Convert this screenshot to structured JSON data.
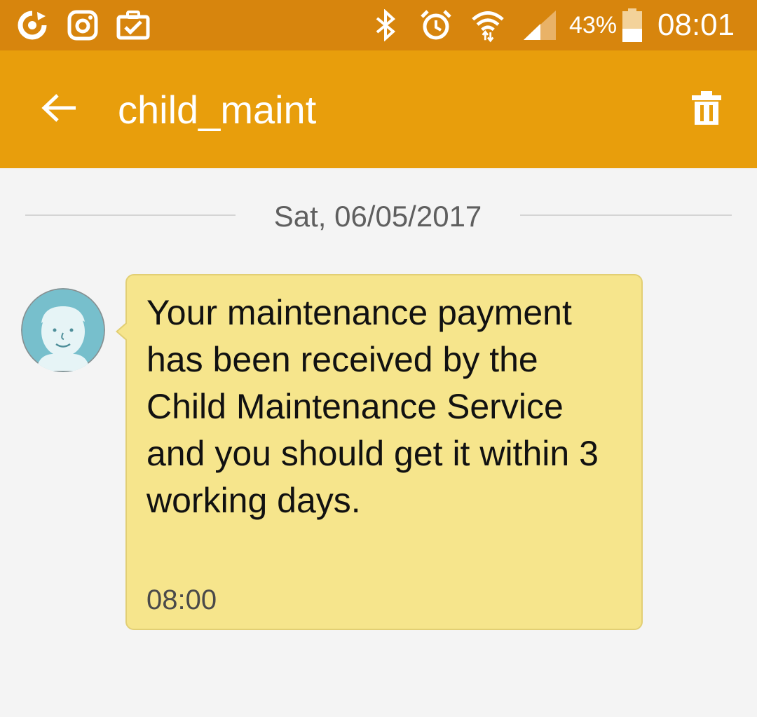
{
  "status_bar": {
    "left_icons": [
      "sync-icon",
      "instagram-icon",
      "briefcase-check-icon"
    ],
    "right_icons": [
      "bluetooth-icon",
      "alarm-icon",
      "wifi-icon",
      "signal-icon",
      "battery-icon"
    ],
    "battery_percent": "43%",
    "battery_level": 0.43,
    "time": "08:01",
    "color": "#d7850d"
  },
  "app_bar": {
    "title": "child_maint",
    "back_icon": "back-arrow-icon",
    "delete_icon": "trash-icon",
    "color": "#e89e0c"
  },
  "conversation": {
    "date_separator": "Sat, 06/05/2017",
    "messages": [
      {
        "text": "Your maintenance payment has been received by the Child Maintenance Service and you should get it within 3 working days.",
        "time": "08:00",
        "bubble_color": "#f6e58c",
        "avatar_icon": "default-contact-avatar-icon",
        "avatar_color": "#77bfcc"
      }
    ]
  }
}
